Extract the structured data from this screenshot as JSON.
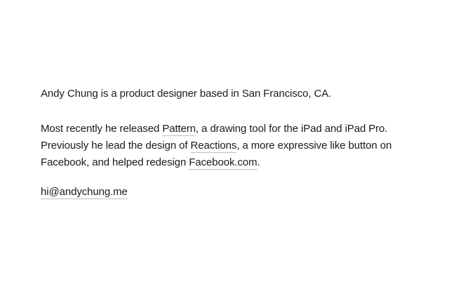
{
  "intro": {
    "text": "Andy Chung is a product designer based in San Francisco, CA."
  },
  "bio": {
    "part1": "Most recently he released ",
    "pattern_link": "Pattern",
    "part2": ", a drawing tool for the iPad and iPad Pro. Previously he lead the design of ",
    "reactions_link": "Reactions",
    "part3": ", a more expressive like button on Facebook, and helped redesign ",
    "facebook_link": "Facebook.com",
    "part4": "."
  },
  "contact": {
    "email": "hi@andychung.me"
  },
  "colors": {
    "text": "#1a1a1a",
    "link_underline": "#bdbdbd",
    "background": "#ffffff"
  }
}
